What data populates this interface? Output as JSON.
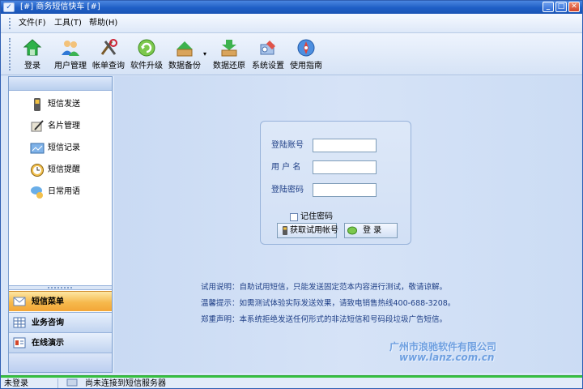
{
  "window": {
    "title": "[#] 商务短信快车 [#]"
  },
  "menubar": {
    "items": [
      "文件(F)",
      "工具(T)",
      "帮助(H)"
    ]
  },
  "toolbar": {
    "buttons": [
      {
        "label": "登录",
        "icon": "login-icon"
      },
      {
        "label": "用户管理",
        "icon": "users-icon"
      },
      {
        "label": "帐单查询",
        "icon": "bill-query-icon"
      },
      {
        "label": "软件升级",
        "icon": "upgrade-icon"
      },
      {
        "label": "数据备份",
        "icon": "backup-icon"
      },
      {
        "label": "数据还原",
        "icon": "restore-icon"
      },
      {
        "label": "系统设置",
        "icon": "settings-icon"
      },
      {
        "label": "使用指南",
        "icon": "guide-icon"
      }
    ]
  },
  "sidebar": {
    "items": [
      {
        "label": "短信发送",
        "icon": "phone-icon"
      },
      {
        "label": "名片管理",
        "icon": "card-icon"
      },
      {
        "label": "短信记录",
        "icon": "record-icon"
      },
      {
        "label": "短信提醒",
        "icon": "clock-icon"
      },
      {
        "label": "日常用语",
        "icon": "chat-icon"
      }
    ],
    "categories": [
      {
        "label": "短信菜单",
        "active": true,
        "icon": "mail-icon"
      },
      {
        "label": "业务咨询",
        "active": false,
        "icon": "grid-icon"
      },
      {
        "label": "在线演示",
        "active": false,
        "icon": "demo-icon"
      }
    ]
  },
  "login": {
    "account_label": "登陆账号",
    "account_value": "",
    "username_label": "用 户 名",
    "username_value": "",
    "password_label": "登陆密码",
    "password_value": "",
    "remember_label": "记住密码",
    "trial_button": "获取试用帐号",
    "login_button": "登  录"
  },
  "info": {
    "line1": "试用说明：自助试用短信，只能发送固定范本内容进行测试，敬请谅解。",
    "line2": "温馨提示：如需测试体验实际发送效果，请致电销售热线400-688-3208。",
    "line3": "郑重声明：本系统拒绝发送任何形式的非法短信和号码段垃圾广告短信。"
  },
  "watermark": {
    "line1": "广州市浪驰软件有限公司",
    "line2": "www.lanz.com.cn"
  },
  "status": {
    "login_state": "未登录",
    "connection": "尚未连接到短信服务器"
  },
  "colors": {
    "title_bar": "#1f5ec5",
    "active_category": "#f6b94d",
    "status_strip": "#34c23f"
  }
}
